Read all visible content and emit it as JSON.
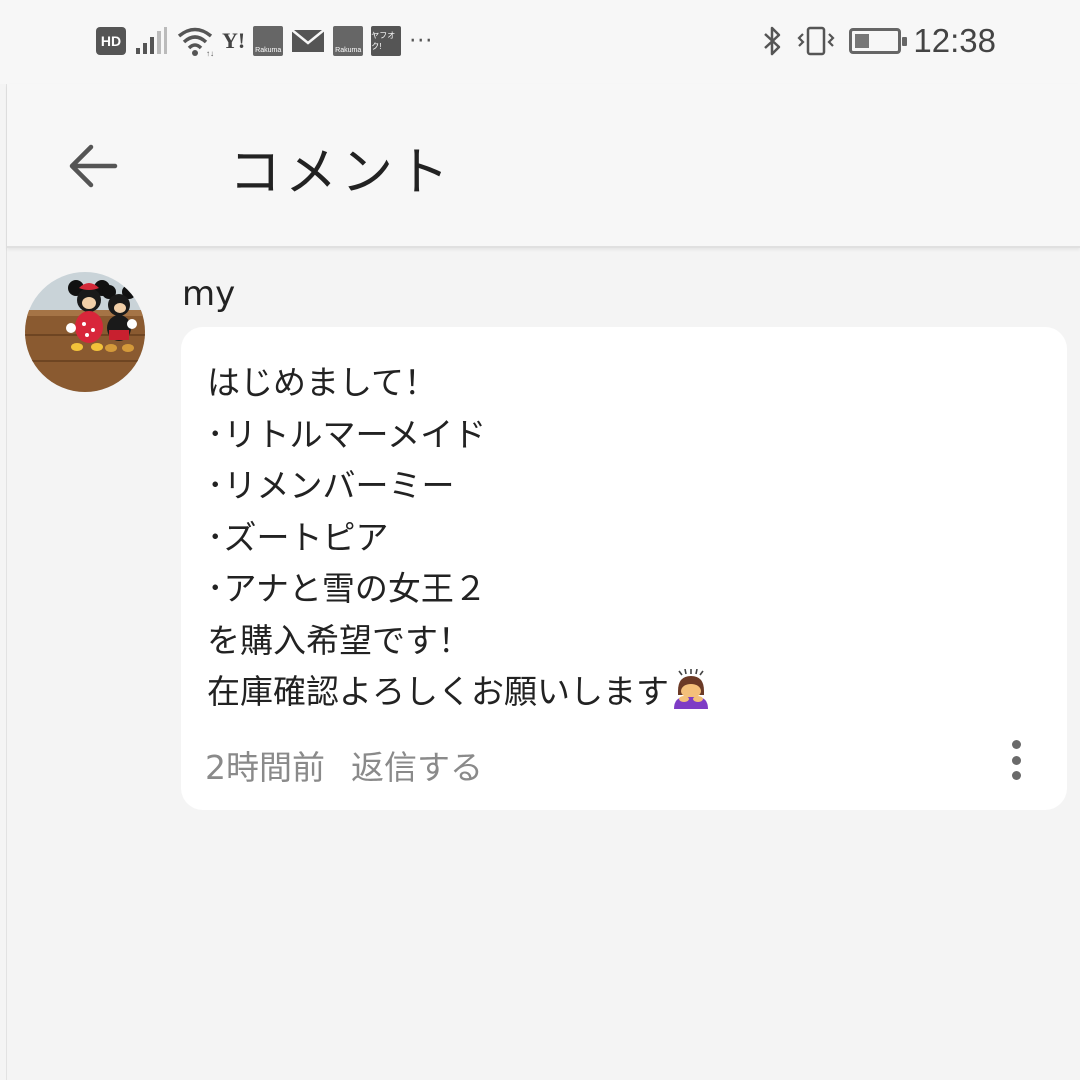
{
  "status_bar": {
    "hd_label": "HD",
    "yahoo_label": "Y!",
    "app_label_1": "Rakuma",
    "app_label_2": "Rakuma",
    "app_label_3": "ヤフオク!",
    "more_indicator": "···",
    "bluetooth_glyph": "∗",
    "battery_level": 0.35,
    "time": "12:38",
    "icons": [
      "hd-icon",
      "signal-icon",
      "wifi-icon",
      "yahoo-icon",
      "rakuma-icon",
      "mail-icon",
      "rakuma-icon",
      "yahuoku-icon",
      "more-notifications-icon",
      "bluetooth-icon",
      "vibrate-icon",
      "battery-icon"
    ]
  },
  "header": {
    "back_icon": "arrow-left-icon",
    "title": "コメント"
  },
  "comment": {
    "author": "my",
    "avatar_icon": "avatar-image",
    "body_lines": [
      "はじめまして！",
      "･リトルマーメイド",
      "･リメンバーミー",
      "･ズートピア",
      "･アナと雪の女王２",
      "を購入希望です！",
      "在庫確認よろしくお願いします"
    ],
    "trailing_emoji": "🙇‍♀️",
    "time_ago": "2時間前",
    "reply_label": "返信する",
    "more_icon": "more-vertical-icon"
  },
  "colors": {
    "background": "#f4f4f4",
    "bar_background": "#f7f7f7",
    "bubble": "#ffffff",
    "text": "#222222",
    "muted_text": "#8a8a8a",
    "emoji_hair": "#6b3a26",
    "emoji_shirt": "#7e3cc5"
  }
}
